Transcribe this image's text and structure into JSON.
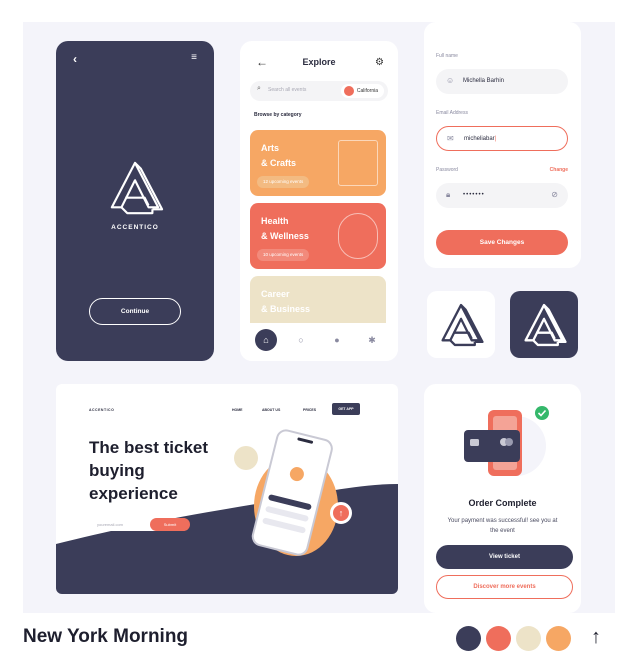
{
  "splash": {
    "back": "‹",
    "menu": "≡",
    "brand": "ACCENTICO",
    "continue_label": "Continue"
  },
  "explore": {
    "title": "Explore",
    "back": "←",
    "filter": "⚙",
    "search_placeholder": "Search all events",
    "location": "California",
    "browse_label": "Browse by category",
    "categories": [
      {
        "line1": "Arts",
        "line2": "& Crafts",
        "events": "12 upcoming events",
        "color": "#f6a764"
      },
      {
        "line1": "Health",
        "line2": "& Wellness",
        "events": "10 upcoming events",
        "color": "#ef6e5c"
      },
      {
        "line1": "Career",
        "line2": "& Business",
        "events": "",
        "color": "#ede3c8"
      }
    ],
    "tabs": [
      "⌂",
      "○",
      "●",
      "✱"
    ]
  },
  "form": {
    "fullname_label": "Full name",
    "fullname_value": "Michella Barhin",
    "email_label": "Email Address",
    "email_value": "micheliabar",
    "password_label": "Password",
    "password_change": "Change",
    "password_value": "•••••••",
    "save_label": "Save Changes"
  },
  "landing": {
    "brand": "ACCENTICO",
    "nav": [
      "HOME",
      "ABOUT US",
      "PRICES"
    ],
    "get_app": "GET APP",
    "headline": "The best ticket buying experience",
    "email_placeholder": "youremail.com",
    "submit_label": "Submit"
  },
  "order": {
    "title": "Order Complete",
    "desc": "Your payment was successful! see you at the event",
    "view_label": "View ticket",
    "discover_label": "Discover more events"
  },
  "footer": {
    "title": "New York Morning",
    "swatches": [
      "#3b3d59",
      "#ef6e5c",
      "#ede3c8",
      "#f6a764"
    ],
    "up_icon": "↑"
  }
}
